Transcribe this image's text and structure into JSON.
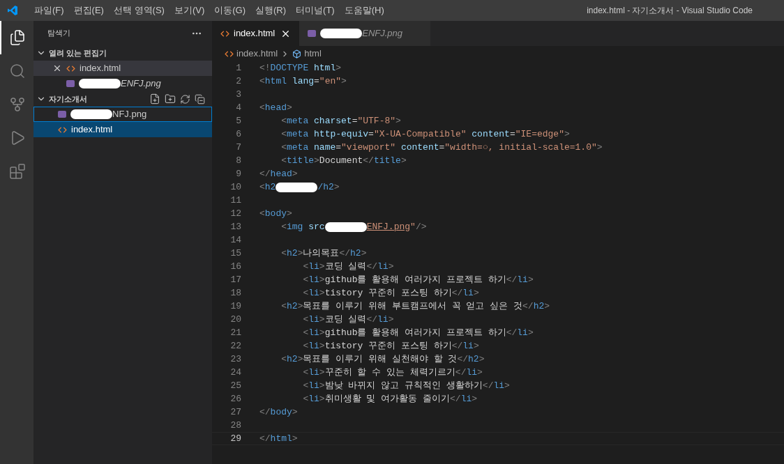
{
  "menu_bar": {
    "items": [
      "파일(F)",
      "편집(E)",
      "선택 영역(S)",
      "보기(V)",
      "이동(G)",
      "실행(R)",
      "터미널(T)",
      "도움말(H)"
    ]
  },
  "window_title": "index.html - 자기소개서 - Visual Studio Code",
  "activity_bar": {
    "items": [
      {
        "kind": "files",
        "selected": true
      },
      {
        "kind": "search",
        "selected": false
      },
      {
        "kind": "source-control",
        "selected": false
      },
      {
        "kind": "run",
        "selected": false
      },
      {
        "kind": "extensions",
        "selected": false
      }
    ]
  },
  "sidebar": {
    "title": "탐색기",
    "sections": [
      {
        "title": "열려 있는 편집기",
        "expanded": true,
        "toolbar": false,
        "items": [
          {
            "label": "index.html",
            "kind": "html",
            "redacted": false,
            "preview": false,
            "closable": true,
            "hovered": true,
            "focused": false,
            "selected": false
          },
          {
            "label": "ENFJ.png",
            "kind": "image",
            "redacted": true,
            "preview": true,
            "closable": false,
            "hovered": false,
            "focused": false,
            "selected": false
          }
        ]
      },
      {
        "title": "자기소개서",
        "expanded": true,
        "toolbar": true,
        "items": [
          {
            "label": "NFJ.png",
            "kind": "image",
            "redacted": true,
            "preview": false,
            "closable": false,
            "focused": true,
            "selected": false
          },
          {
            "label": "index.html",
            "kind": "html",
            "redacted": false,
            "preview": false,
            "closable": false,
            "focused": false,
            "selected": true
          }
        ]
      }
    ]
  },
  "tabs": [
    {
      "label": "index.html",
      "kind": "html",
      "redacted": false,
      "preview": false,
      "selected": true
    },
    {
      "label": "ENFJ.png",
      "kind": "image",
      "redacted": true,
      "preview": true,
      "selected": false
    }
  ],
  "breadcrumb": [
    {
      "label": "index.html",
      "kind": "html"
    },
    {
      "label": "html",
      "kind": "element"
    }
  ],
  "editor": {
    "lines": [
      {
        "number": "1",
        "current": false,
        "tokens": [
          {
            "kind": "punct",
            "text": "<!"
          },
          {
            "kind": "tag",
            "text": "DOCTYPE"
          },
          {
            "kind": "attr",
            "text": " html"
          },
          {
            "kind": "punct",
            "text": ">"
          }
        ]
      },
      {
        "number": "2",
        "current": false,
        "tokens": [
          {
            "kind": "punct",
            "text": "<"
          },
          {
            "kind": "tag",
            "text": "html"
          },
          {
            "kind": "attr",
            "text": " lang"
          },
          {
            "kind": "plain",
            "text": "="
          },
          {
            "kind": "string",
            "text": "\"en\""
          },
          {
            "kind": "punct",
            "text": ">"
          }
        ]
      },
      {
        "number": "3",
        "current": false
      },
      {
        "number": "4",
        "current": false,
        "tokens": [
          {
            "kind": "punct",
            "text": "<"
          },
          {
            "kind": "tag",
            "text": "head"
          },
          {
            "kind": "punct",
            "text": ">"
          }
        ]
      },
      {
        "number": "5",
        "current": false,
        "tokens": [
          {
            "kind": "punct",
            "text": "    <"
          },
          {
            "kind": "tag",
            "text": "meta"
          },
          {
            "kind": "attr",
            "text": " charset"
          },
          {
            "kind": "plain",
            "text": "="
          },
          {
            "kind": "string",
            "text": "\"UTF-8\""
          },
          {
            "kind": "punct",
            "text": ">"
          }
        ]
      },
      {
        "number": "6",
        "current": false,
        "tokens": [
          {
            "kind": "punct",
            "text": "    <"
          },
          {
            "kind": "tag",
            "text": "meta"
          },
          {
            "kind": "attr",
            "text": " http-equiv"
          },
          {
            "kind": "plain",
            "text": "="
          },
          {
            "kind": "string",
            "text": "\"X-UA-Compatible\""
          },
          {
            "kind": "attr",
            "text": " content"
          },
          {
            "kind": "plain",
            "text": "="
          },
          {
            "kind": "string",
            "text": "\"IE=edge\""
          },
          {
            "kind": "punct",
            "text": ">"
          }
        ]
      },
      {
        "number": "7",
        "current": false,
        "tokens": [
          {
            "kind": "punct",
            "text": "    <"
          },
          {
            "kind": "tag",
            "text": "meta"
          },
          {
            "kind": "attr",
            "text": " name"
          },
          {
            "kind": "plain",
            "text": "="
          },
          {
            "kind": "string",
            "text": "\"viewport\""
          },
          {
            "kind": "attr",
            "text": " content"
          },
          {
            "kind": "plain",
            "text": "="
          },
          {
            "kind": "string",
            "text": "\"width=○, initial-scale=1.0\""
          },
          {
            "kind": "punct",
            "text": ">"
          }
        ]
      },
      {
        "number": "8",
        "current": false,
        "tokens": [
          {
            "kind": "punct",
            "text": "    <"
          },
          {
            "kind": "tag",
            "text": "title"
          },
          {
            "kind": "punct",
            "text": ">"
          },
          {
            "kind": "plain",
            "text": "Document"
          },
          {
            "kind": "punct",
            "text": "</"
          },
          {
            "kind": "tag",
            "text": "title"
          },
          {
            "kind": "punct",
            "text": ">"
          }
        ]
      },
      {
        "number": "9",
        "current": false,
        "tokens": [
          {
            "kind": "punct",
            "text": "</"
          },
          {
            "kind": "tag",
            "text": "head"
          },
          {
            "kind": "punct",
            "text": ">"
          }
        ]
      },
      {
        "number": "10",
        "current": false,
        "tokens": [
          {
            "kind": "punct",
            "text": "<"
          },
          {
            "kind": "tag",
            "text": "h2"
          },
          {
            "kind": "redaction"
          },
          {
            "kind": "tag",
            "text": "/h2"
          },
          {
            "kind": "punct",
            "text": ">"
          }
        ]
      },
      {
        "number": "11",
        "current": false
      },
      {
        "number": "12",
        "current": false,
        "tokens": [
          {
            "kind": "punct",
            "text": "<"
          },
          {
            "kind": "tag",
            "text": "body"
          },
          {
            "kind": "punct",
            "text": ">"
          }
        ]
      },
      {
        "number": "13",
        "current": false,
        "tokens": [
          {
            "kind": "punct",
            "text": "    <"
          },
          {
            "kind": "tag",
            "text": "img"
          },
          {
            "kind": "attr",
            "text": " src"
          },
          {
            "kind": "redaction"
          },
          {
            "kind": "link",
            "text": "ENFJ.png"
          },
          {
            "kind": "string",
            "text": "\""
          },
          {
            "kind": "punct",
            "text": "/>"
          }
        ]
      },
      {
        "number": "14",
        "current": false
      },
      {
        "number": "15",
        "current": false,
        "tokens": [
          {
            "kind": "punct",
            "text": "    <"
          },
          {
            "kind": "tag",
            "text": "h2"
          },
          {
            "kind": "punct",
            "text": ">"
          },
          {
            "kind": "plain",
            "text": "나의목표"
          },
          {
            "kind": "punct",
            "text": "</"
          },
          {
            "kind": "tag",
            "text": "h2"
          },
          {
            "kind": "punct",
            "text": ">"
          }
        ]
      },
      {
        "number": "16",
        "current": false,
        "tokens": [
          {
            "kind": "punct",
            "text": "        <"
          },
          {
            "kind": "tag",
            "text": "li"
          },
          {
            "kind": "punct",
            "text": ">"
          },
          {
            "kind": "plain",
            "text": "코딩 실력"
          },
          {
            "kind": "punct",
            "text": "</"
          },
          {
            "kind": "tag",
            "text": "li"
          },
          {
            "kind": "punct",
            "text": ">"
          }
        ]
      },
      {
        "number": "17",
        "current": false,
        "tokens": [
          {
            "kind": "punct",
            "text": "        <"
          },
          {
            "kind": "tag",
            "text": "li"
          },
          {
            "kind": "punct",
            "text": ">"
          },
          {
            "kind": "plain",
            "text": "github를 활용해 여러가지 프로젝트 하기"
          },
          {
            "kind": "punct",
            "text": "</"
          },
          {
            "kind": "tag",
            "text": "li"
          },
          {
            "kind": "punct",
            "text": ">"
          }
        ]
      },
      {
        "number": "18",
        "current": false,
        "tokens": [
          {
            "kind": "punct",
            "text": "        <"
          },
          {
            "kind": "tag",
            "text": "li"
          },
          {
            "kind": "punct",
            "text": ">"
          },
          {
            "kind": "plain",
            "text": "tistory 꾸준히 포스팅 하기"
          },
          {
            "kind": "punct",
            "text": "</"
          },
          {
            "kind": "tag",
            "text": "li"
          },
          {
            "kind": "punct",
            "text": ">"
          }
        ]
      },
      {
        "number": "19",
        "current": false,
        "tokens": [
          {
            "kind": "punct",
            "text": "    <"
          },
          {
            "kind": "tag",
            "text": "h2"
          },
          {
            "kind": "punct",
            "text": ">"
          },
          {
            "kind": "plain",
            "text": "목표를 이루기 위해 부트캠프에서 꼭 얻고 싶은 것"
          },
          {
            "kind": "punct",
            "text": "</"
          },
          {
            "kind": "tag",
            "text": "h2"
          },
          {
            "kind": "punct",
            "text": ">"
          }
        ]
      },
      {
        "number": "20",
        "current": false,
        "tokens": [
          {
            "kind": "punct",
            "text": "        <"
          },
          {
            "kind": "tag",
            "text": "li"
          },
          {
            "kind": "punct",
            "text": ">"
          },
          {
            "kind": "plain",
            "text": "코딩 실력"
          },
          {
            "kind": "punct",
            "text": "</"
          },
          {
            "kind": "tag",
            "text": "li"
          },
          {
            "kind": "punct",
            "text": ">"
          }
        ]
      },
      {
        "number": "21",
        "current": false,
        "tokens": [
          {
            "kind": "punct",
            "text": "        <"
          },
          {
            "kind": "tag",
            "text": "li"
          },
          {
            "kind": "punct",
            "text": ">"
          },
          {
            "kind": "plain",
            "text": "github를 활용해 여러가지 프로젝트 하기"
          },
          {
            "kind": "punct",
            "text": "</"
          },
          {
            "kind": "tag",
            "text": "li"
          },
          {
            "kind": "punct",
            "text": ">"
          }
        ]
      },
      {
        "number": "22",
        "current": false,
        "tokens": [
          {
            "kind": "punct",
            "text": "        <"
          },
          {
            "kind": "tag",
            "text": "li"
          },
          {
            "kind": "punct",
            "text": ">"
          },
          {
            "kind": "plain",
            "text": "tistory 꾸준히 포스팅 하기"
          },
          {
            "kind": "punct",
            "text": "</"
          },
          {
            "kind": "tag",
            "text": "li"
          },
          {
            "kind": "punct",
            "text": ">"
          }
        ]
      },
      {
        "number": "23",
        "current": false,
        "tokens": [
          {
            "kind": "punct",
            "text": "    <"
          },
          {
            "kind": "tag",
            "text": "h2"
          },
          {
            "kind": "punct",
            "text": ">"
          },
          {
            "kind": "plain",
            "text": "목표를 이루기 위해 실천해야 할 것"
          },
          {
            "kind": "punct",
            "text": "</"
          },
          {
            "kind": "tag",
            "text": "h2"
          },
          {
            "kind": "punct",
            "text": ">"
          }
        ]
      },
      {
        "number": "24",
        "current": false,
        "tokens": [
          {
            "kind": "punct",
            "text": "        <"
          },
          {
            "kind": "tag",
            "text": "li"
          },
          {
            "kind": "punct",
            "text": ">"
          },
          {
            "kind": "plain",
            "text": "꾸준히 할 수 있는 체력기르기"
          },
          {
            "kind": "punct",
            "text": "</"
          },
          {
            "kind": "tag",
            "text": "li"
          },
          {
            "kind": "punct",
            "text": ">"
          }
        ]
      },
      {
        "number": "25",
        "current": false,
        "tokens": [
          {
            "kind": "punct",
            "text": "        <"
          },
          {
            "kind": "tag",
            "text": "li"
          },
          {
            "kind": "punct",
            "text": ">"
          },
          {
            "kind": "plain",
            "text": "밤낮 바뀌지 않고 규칙적인 생활하기"
          },
          {
            "kind": "punct",
            "text": "</"
          },
          {
            "kind": "tag",
            "text": "li"
          },
          {
            "kind": "punct",
            "text": ">"
          }
        ]
      },
      {
        "number": "26",
        "current": false,
        "tokens": [
          {
            "kind": "punct",
            "text": "        <"
          },
          {
            "kind": "tag",
            "text": "li"
          },
          {
            "kind": "punct",
            "text": ">"
          },
          {
            "kind": "plain",
            "text": "취미생활 및 여가활동 줄이기"
          },
          {
            "kind": "punct",
            "text": "</"
          },
          {
            "kind": "tag",
            "text": "li"
          },
          {
            "kind": "punct",
            "text": ">"
          }
        ]
      },
      {
        "number": "27",
        "current": false,
        "tokens": [
          {
            "kind": "punct",
            "text": "</"
          },
          {
            "kind": "tag",
            "text": "body"
          },
          {
            "kind": "punct",
            "text": ">"
          }
        ]
      },
      {
        "number": "28",
        "current": false
      },
      {
        "number": "29",
        "current": true,
        "tokens": [
          {
            "kind": "punct",
            "text": "</"
          },
          {
            "kind": "tag",
            "text": "html"
          },
          {
            "kind": "punct",
            "text": ">"
          }
        ]
      }
    ]
  }
}
